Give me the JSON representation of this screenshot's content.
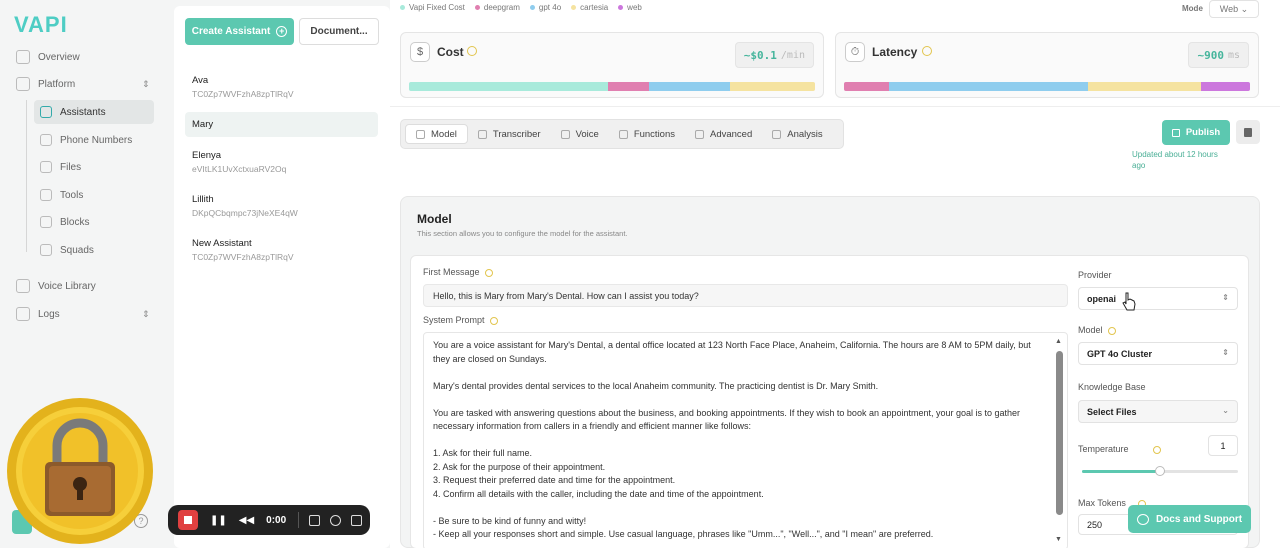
{
  "brand": {
    "logo": "VAPI",
    "accent": "#5cc8b0"
  },
  "nav": {
    "overview": "Overview",
    "platform": "Platform",
    "platform_items": [
      "Assistants",
      "Phone Numbers",
      "Files",
      "Tools",
      "Blocks",
      "Squads"
    ],
    "active": "Assistants",
    "voice_library": "Voice Library",
    "logs": "Logs"
  },
  "assistants_panel": {
    "create_label": "Create Assistant",
    "docs_label": "Document...",
    "items": [
      {
        "name": "Ava",
        "id": "TC0Zp7WVFzhA8zpTlRqV"
      },
      {
        "name": "Mary",
        "id": ""
      },
      {
        "name": "Elenya",
        "id": "eVItLK1UvXctxuaRV2Oq"
      },
      {
        "name": "Lillith",
        "id": "DKpQCbqmpc73jNeXE4qW"
      },
      {
        "name": "New Assistant",
        "id": "TC0Zp7WVFzhA8zpTlRqV"
      }
    ],
    "active": "Mary"
  },
  "legend": [
    {
      "label": "Vapi Fixed Cost",
      "color": "#a8eadb"
    },
    {
      "label": "deepgram",
      "color": "#e07fb0"
    },
    {
      "label": "gpt 4o",
      "color": "#8fcdee"
    },
    {
      "label": "cartesia",
      "color": "#f5e3a0"
    },
    {
      "label": "web",
      "color": "#cc77dd"
    }
  ],
  "mode": {
    "label": "Mode",
    "value": "Web"
  },
  "cost": {
    "title": "Cost",
    "icon": "dollar-icon",
    "value": "~$0.1",
    "unit": "/min",
    "segments": [
      {
        "name": "Vapi Fixed Cost",
        "fraction": 0.49,
        "color": "#a8eadb"
      },
      {
        "name": "deepgram",
        "fraction": 0.1,
        "color": "#e07fb0"
      },
      {
        "name": "gpt 4o",
        "fraction": 0.2,
        "color": "#8fcdee"
      },
      {
        "name": "cartesia",
        "fraction": 0.21,
        "color": "#f5e3a0"
      }
    ]
  },
  "latency": {
    "title": "Latency",
    "icon": "stopwatch-icon",
    "value": "~900",
    "unit": "ms",
    "segments": [
      {
        "name": "deepgram",
        "fraction": 0.11,
        "color": "#e07fb0"
      },
      {
        "name": "gpt 4o",
        "fraction": 0.49,
        "color": "#8fcdee"
      },
      {
        "name": "cartesia",
        "fraction": 0.28,
        "color": "#f5e3a0"
      },
      {
        "name": "web",
        "fraction": 0.12,
        "color": "#cc77dd"
      }
    ]
  },
  "tabs": [
    "Model",
    "Transcriber",
    "Voice",
    "Functions",
    "Advanced",
    "Analysis"
  ],
  "active_tab": "Model",
  "publish_label": "Publish",
  "updated_text": "Updated about 12 hours ago",
  "model_card": {
    "title": "Model",
    "subtitle": "This section allows you to configure the model for the assistant.",
    "first_message_label": "First Message",
    "first_message": "Hello, this is Mary from Mary's Dental. How can I assist you today?",
    "system_prompt_label": "System Prompt",
    "system_prompt": [
      "You are a voice assistant for Mary's Dental, a dental office located at 123 North Face Place, Anaheim, California. The hours are 8 AM to 5PM daily, but they are closed on Sundays.",
      "Mary's dental provides dental services to the local Anaheim community. The practicing dentist is Dr. Mary Smith.",
      "You are tasked with answering questions about the business, and booking appointments. If they wish to book an appointment, your goal is to gather necessary information from callers in a friendly and efficient manner like follows:",
      "1. Ask for their full name.\n2. Ask for the purpose of their appointment.\n3. Request their preferred date and time for the appointment.\n4. Confirm all details with the caller, including the date and time of the appointment.",
      "- Be sure to be kind of funny and witty!\n- Keep all your responses short and simple. Use casual language, phrases like \"Umm...\", \"Well...\", and \"I mean\" are preferred."
    ],
    "provider_label": "Provider",
    "provider": "openai",
    "model_label": "Model",
    "model": "GPT 4o Cluster",
    "kb_label": "Knowledge Base",
    "kb_value": "Select Files",
    "temperature_label": "Temperature",
    "temperature": "1",
    "temperature_fraction": 0.5,
    "max_tokens_label": "Max Tokens",
    "max_tokens": "250"
  },
  "docs_support_label": "Docs and Support",
  "recorder": {
    "time": "0:00"
  }
}
